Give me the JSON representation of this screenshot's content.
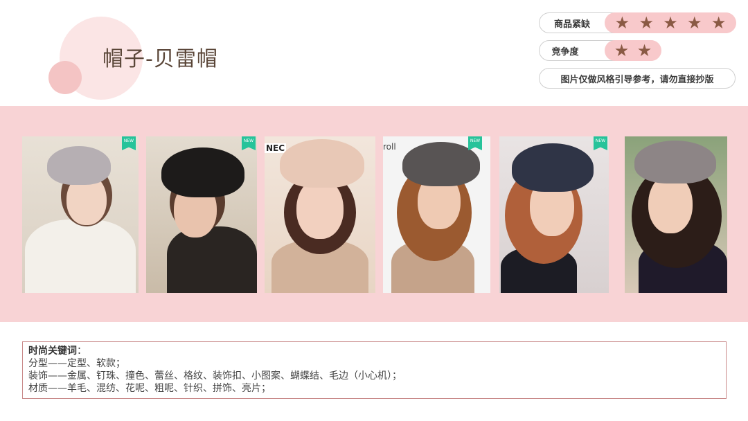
{
  "title": "帽子-贝雷帽",
  "ratings": [
    {
      "label": "商品紧缺",
      "stars": 5
    },
    {
      "label": "竞争度",
      "stars": 2
    }
  ],
  "star_glyph": "★",
  "note": "图片仅做风格引导参考，请勿直接抄版",
  "colors": {
    "band": "#f8d3d5",
    "star": "#8a5a44",
    "star_bg": "#f8c9cb",
    "new_tag": "#26c39a"
  },
  "gallery": {
    "new_tag": "NEW",
    "brand_texts": [
      "NEC",
      "roll"
    ]
  },
  "keywords": {
    "heading": "时尚关键词",
    "heading_suffix": "：",
    "lines": [
      "分型——定型、软款；",
      "装饰——金属、钉珠、撞色、蕾丝、格纹、装饰扣、小图案、蝴蝶结、毛边（小心机）；",
      "材质——羊毛、混纺、花呢、粗呢、针织、拼饰、亮片；"
    ]
  }
}
